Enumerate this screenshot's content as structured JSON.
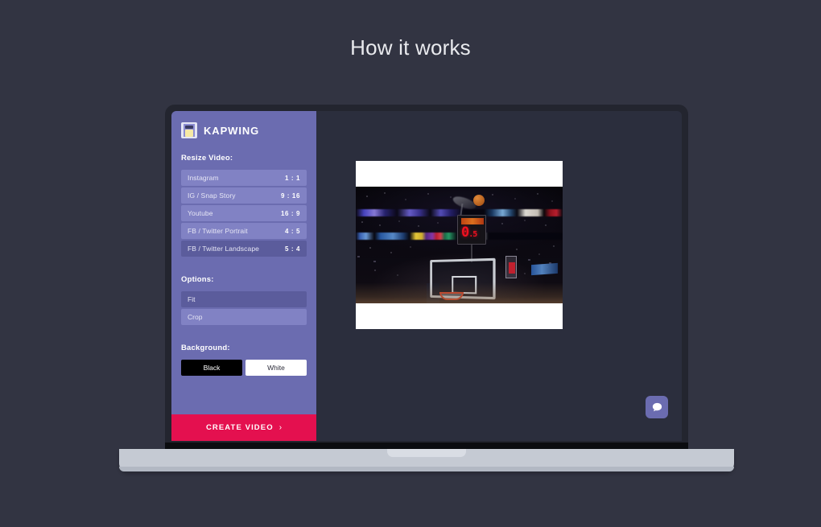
{
  "page": {
    "title": "How it works",
    "background_color": "#323442"
  },
  "app": {
    "brand_name": "KAPWING",
    "brand_icon": "kapwing-logo-icon",
    "sidebar_color": "#6b6cb0",
    "accent_color": "#e4104f",
    "resize": {
      "label": "Resize Video:",
      "options": [
        {
          "name": "Instagram",
          "ratio": "1 : 1",
          "selected": false
        },
        {
          "name": "IG / Snap Story",
          "ratio": "9 : 16",
          "selected": false
        },
        {
          "name": "Youtube",
          "ratio": "16 : 9",
          "selected": false
        },
        {
          "name": "FB / Twitter Portrait",
          "ratio": "4 : 5",
          "selected": false
        },
        {
          "name": "FB / Twitter Landscape",
          "ratio": "5 : 4",
          "selected": true
        }
      ]
    },
    "options": {
      "label": "Options:",
      "items": [
        {
          "label": "Fit",
          "selected": true
        },
        {
          "label": "Crop",
          "selected": false
        }
      ]
    },
    "background": {
      "label": "Background:",
      "items": [
        {
          "label": "Black",
          "selected": false
        },
        {
          "label": "White",
          "selected": true
        }
      ]
    },
    "create_button": {
      "label": "CREATE VIDEO",
      "chevron": "›"
    },
    "canvas": {
      "preview_description": "Basketball arena video preview letterboxed with white bars",
      "scoreboard_value": "0",
      "scoreboard_decimal": ".5"
    },
    "chat_button": {
      "icon": "chat-bubble-icon"
    }
  }
}
